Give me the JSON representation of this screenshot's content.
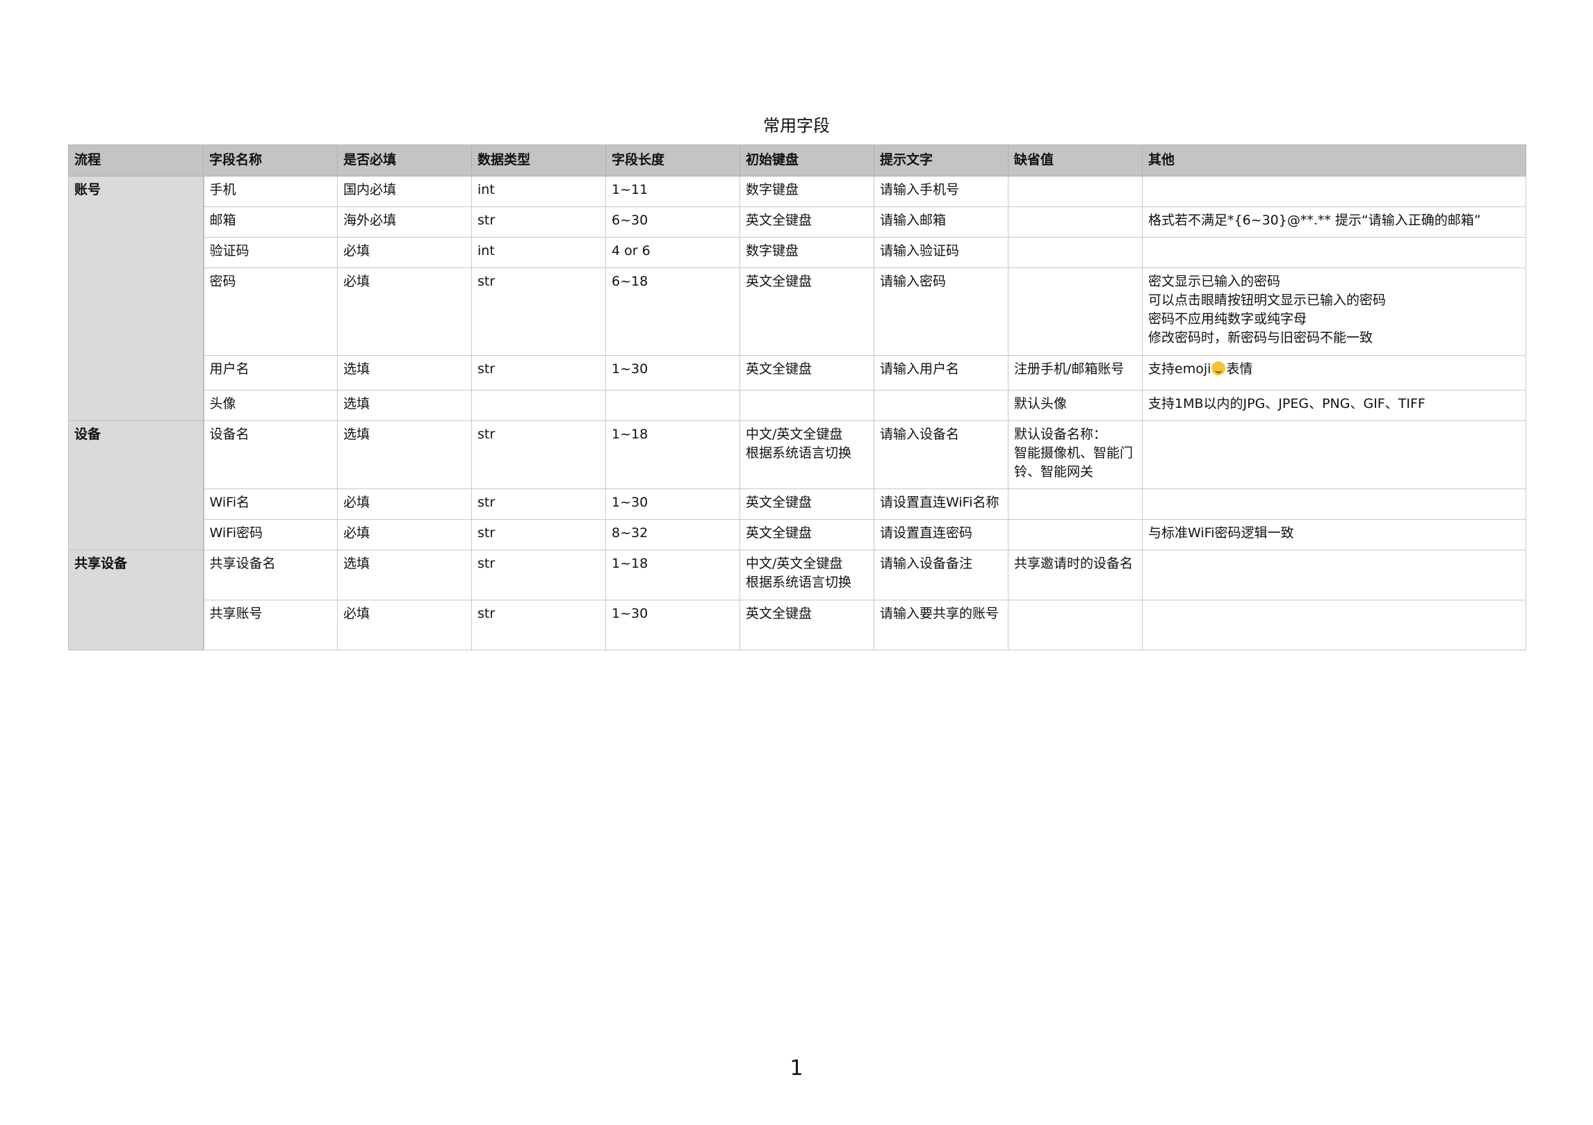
{
  "title": "常用字段",
  "page_number": "1",
  "columns": [
    "流程",
    "字段名称",
    "是否必填",
    "数据类型",
    "字段长度",
    "初始键盘",
    "提示文字",
    "缺省值",
    "其他"
  ],
  "groups": [
    {
      "name": "账号",
      "rows": [
        {
          "name": "手机",
          "required": "国内必填",
          "type": "int",
          "length": "1~11",
          "keyboard": "数字键盘",
          "hint": "请输入手机号",
          "default": "",
          "other": ""
        },
        {
          "name": "邮箱",
          "required": "海外必填",
          "type": "str",
          "length": "6~30",
          "keyboard": "英文全键盘",
          "hint": "请输入邮箱",
          "default": "",
          "other": "格式若不满足*{6~30}@**.**  提示“请输入正确的邮箱”"
        },
        {
          "name": "验证码",
          "required": "必填",
          "type": "int",
          "length": "4 or 6",
          "keyboard": "数字键盘",
          "hint": "请输入验证码",
          "default": "",
          "other": ""
        },
        {
          "name": "密码",
          "required": "必填",
          "type": "str",
          "length": "6~18",
          "keyboard": "英文全键盘",
          "hint": "请输入密码",
          "default": "",
          "other": "密文显示已输入的密码\n可以点击眼睛按钮明文显示已输入的密码\n密码不应用纯数字或纯字母\n修改密码时，新密码与旧密码不能一致"
        },
        {
          "name": "用户名",
          "required": "选填",
          "type": "str",
          "length": "1~30",
          "keyboard": "英文全键盘",
          "hint": "请输入用户名",
          "default": "注册手机/邮箱账号",
          "other_prefix": "支持emoji",
          "other_emoji": "smiling-face-emoji",
          "other_suffix": "表情"
        },
        {
          "name": "头像",
          "required": "选填",
          "type": "",
          "length": "",
          "keyboard": "",
          "hint": "",
          "default": "默认头像",
          "other": "支持1MB以内的JPG、JPEG、PNG、GIF、TIFF"
        }
      ]
    },
    {
      "name": "设备",
      "rows": [
        {
          "name": "设备名",
          "required": "选填",
          "type": "str",
          "length": "1~18",
          "keyboard": "中文/英文全键盘\n根据系统语言切换",
          "hint": "请输入设备名",
          "default": "默认设备名称：\n智能摄像机、智能门铃、智能网关",
          "other": ""
        },
        {
          "name": "WiFi名",
          "required": "必填",
          "type": "str",
          "length": "1~30",
          "keyboard": "英文全键盘",
          "hint": "请设置直连WiFi名称",
          "default": "",
          "other": ""
        },
        {
          "name": "WiFi密码",
          "required": "必填",
          "type": "str",
          "length": "8~32",
          "keyboard": "英文全键盘",
          "hint": "请设置直连密码",
          "default": "",
          "other": "与标准WiFi密码逻辑一致"
        }
      ]
    },
    {
      "name": "共享设备",
      "rows": [
        {
          "name": "共享设备名",
          "required": "选填",
          "type": "str",
          "length": "1~18",
          "keyboard": "中文/英文全键盘\n根据系统语言切换",
          "hint": "请输入设备备注",
          "default": "共享邀请时的设备名",
          "other": ""
        },
        {
          "name": "共享账号",
          "required": "必填",
          "type": "str",
          "length": "1~30",
          "keyboard": "英文全键盘",
          "hint": "请输入要共享的账号",
          "default": "",
          "other": ""
        }
      ]
    }
  ]
}
